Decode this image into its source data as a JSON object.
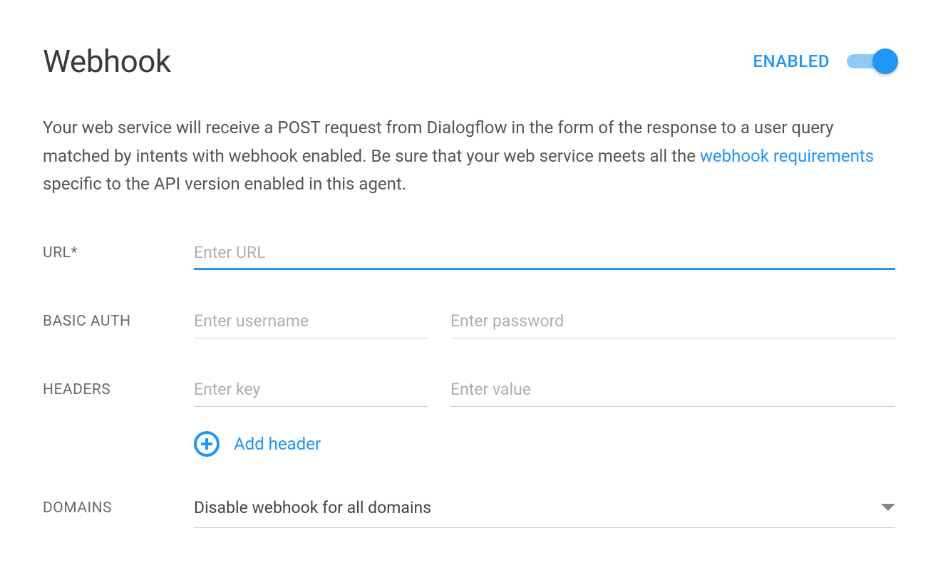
{
  "header": {
    "title": "Webhook",
    "enabled_label": "ENABLED"
  },
  "description": {
    "text_before_link": "Your web service will receive a POST request from Dialogflow in the form of the response to a user query matched by intents with webhook enabled. Be sure that your web service meets all the ",
    "link_text": "webhook requirements",
    "text_after_link": " specific to the API version enabled in this agent."
  },
  "form": {
    "url": {
      "label": "URL*",
      "placeholder": "Enter URL",
      "value": ""
    },
    "basic_auth": {
      "label": "BASIC AUTH",
      "username_placeholder": "Enter username",
      "username_value": "",
      "password_placeholder": "Enter password",
      "password_value": ""
    },
    "headers": {
      "label": "HEADERS",
      "key_placeholder": "Enter key",
      "key_value": "",
      "value_placeholder": "Enter value",
      "value_value": "",
      "add_label": "Add header"
    },
    "domains": {
      "label": "DOMAINS",
      "selected": "Disable webhook for all domains"
    }
  }
}
